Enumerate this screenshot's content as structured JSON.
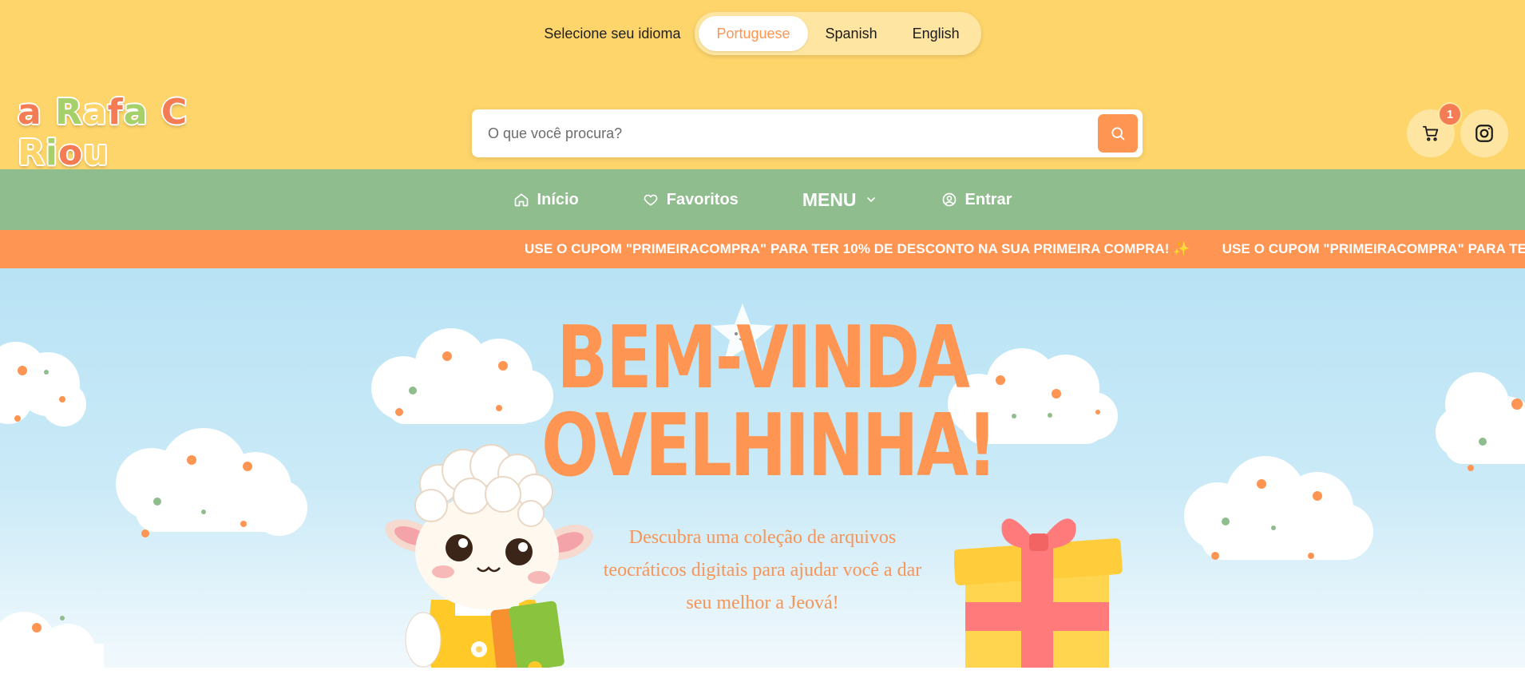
{
  "language": {
    "prompt": "Selecione seu idioma",
    "options": [
      "Portuguese",
      "Spanish",
      "English"
    ],
    "selected": "Portuguese"
  },
  "brand": {
    "logo_text": "a Rafa CRiou",
    "colors": {
      "yellow": "#FED56B",
      "green": "#8FBD8E",
      "orange": "#FF9553"
    }
  },
  "search": {
    "placeholder": "O que você procura?",
    "value": ""
  },
  "cart": {
    "count": "1"
  },
  "nav": {
    "items": [
      {
        "label": "Início",
        "icon": "home-icon"
      },
      {
        "label": "Favoritos",
        "icon": "heart-icon"
      },
      {
        "label": "MENU",
        "icon": "chevron-down-icon"
      },
      {
        "label": "Entrar",
        "icon": "user-circle-icon"
      }
    ]
  },
  "promo": {
    "text": "USE O CUPOM \"PRIMEIRACOMPRA\" PARA TER 10% DE DESCONTO NA SUA PRIMEIRA COMPRA!",
    "sparkle": "✨"
  },
  "hero": {
    "title_line1": "BEM-VINDA",
    "title_line2": "OVELHINHA!",
    "subtitle": "Descubra uma coleção de arquivos teocráticos digitais para ajudar você a dar seu melhor a Jeová!"
  }
}
